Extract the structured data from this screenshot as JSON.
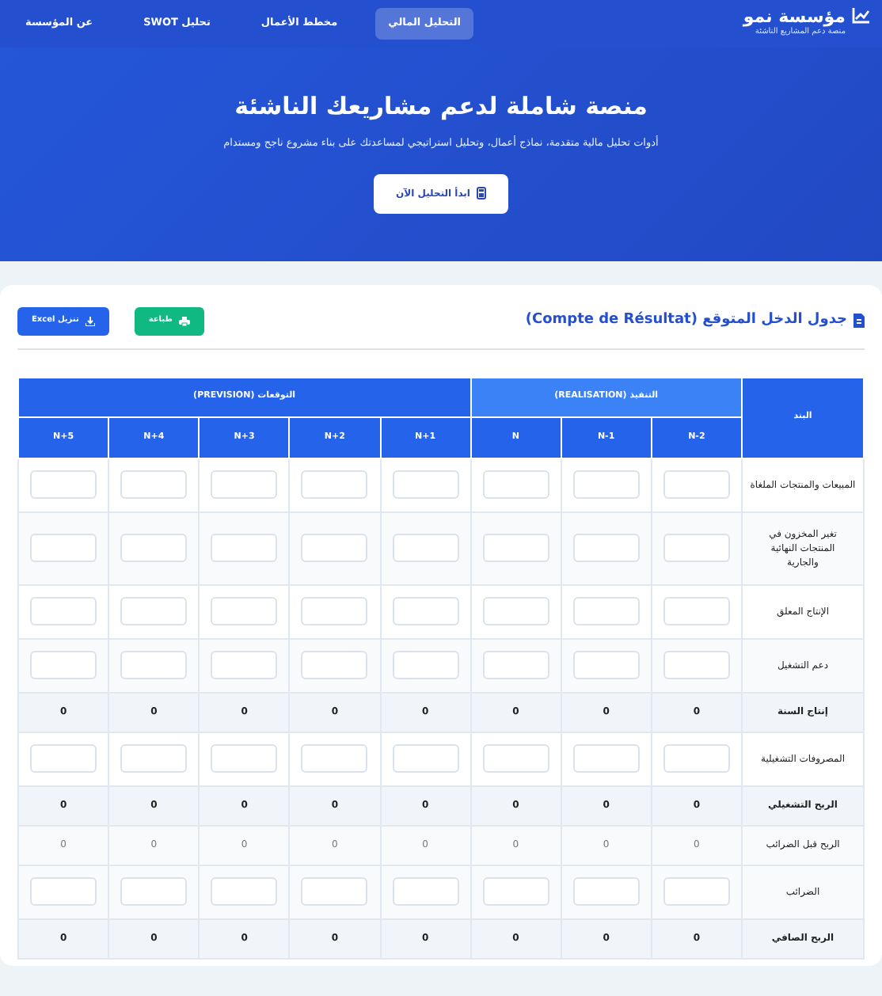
{
  "navbar": {
    "brand": "مؤسسة نمو",
    "tagline": "منصة دعم المشاريع الناشئة",
    "links": [
      {
        "label": "التحليل المالي",
        "selected": true
      },
      {
        "label": "مخطط الأعمال",
        "selected": false
      },
      {
        "label": "تحليل SWOT",
        "selected": false
      },
      {
        "label": "عن المؤسسة",
        "selected": false
      }
    ]
  },
  "hero": {
    "title": "منصة شاملة لدعم مشاريعك الناشئة",
    "subtitle": "أدوات تحليل مالية متقدمة، نماذج أعمال، وتحليل استراتيجي لمساعدتك على بناء مشروع ناجح ومستدام",
    "button": "ابدأ التحليل الآن"
  },
  "card": {
    "title": "جدول الدخل المتوقع (Compte de Résultat)",
    "buttons": [
      {
        "label": "طباعة",
        "kind": "print"
      },
      {
        "label": "تنزيل Excel",
        "kind": "download"
      }
    ]
  },
  "table": {
    "item_header": "البند",
    "groups": [
      {
        "label": "التنفيذ (REALISATION)",
        "kind": "realisation",
        "columns": [
          "N-2",
          "N-1",
          "N"
        ]
      },
      {
        "label": "التوقعات (PREVISION)",
        "kind": "prevision",
        "columns": [
          "N+1",
          "N+2",
          "N+3",
          "N+4",
          "N+5"
        ]
      }
    ],
    "rows": [
      {
        "label": "المبيعات والمنتجات الملغاة",
        "kind": "input"
      },
      {
        "label": "تغير المخزون في المنتجات النهائية والجارية",
        "kind": "input"
      },
      {
        "label": "الإنتاج المعلق",
        "kind": "input"
      },
      {
        "label": "دعم التشغيل",
        "kind": "input"
      },
      {
        "label": "إنتاج السنة",
        "kind": "total",
        "values": [
          "0",
          "0",
          "0",
          "0",
          "0",
          "0",
          "0",
          "0"
        ]
      },
      {
        "label": "المصروفات التشغيلية",
        "kind": "input"
      },
      {
        "label": "الربح التشغيلي",
        "kind": "total",
        "values": [
          "0",
          "0",
          "0",
          "0",
          "0",
          "0",
          "0",
          "0"
        ]
      },
      {
        "label": "الربح قبل الضرائب",
        "kind": "subtotal",
        "values": [
          "0",
          "0",
          "0",
          "0",
          "0",
          "0",
          "0",
          "0"
        ]
      },
      {
        "label": "الضرائب",
        "kind": "input"
      },
      {
        "label": "الربح الصافي",
        "kind": "total",
        "values": [
          "0",
          "0",
          "0",
          "0",
          "0",
          "0",
          "0",
          "0"
        ]
      }
    ]
  }
}
